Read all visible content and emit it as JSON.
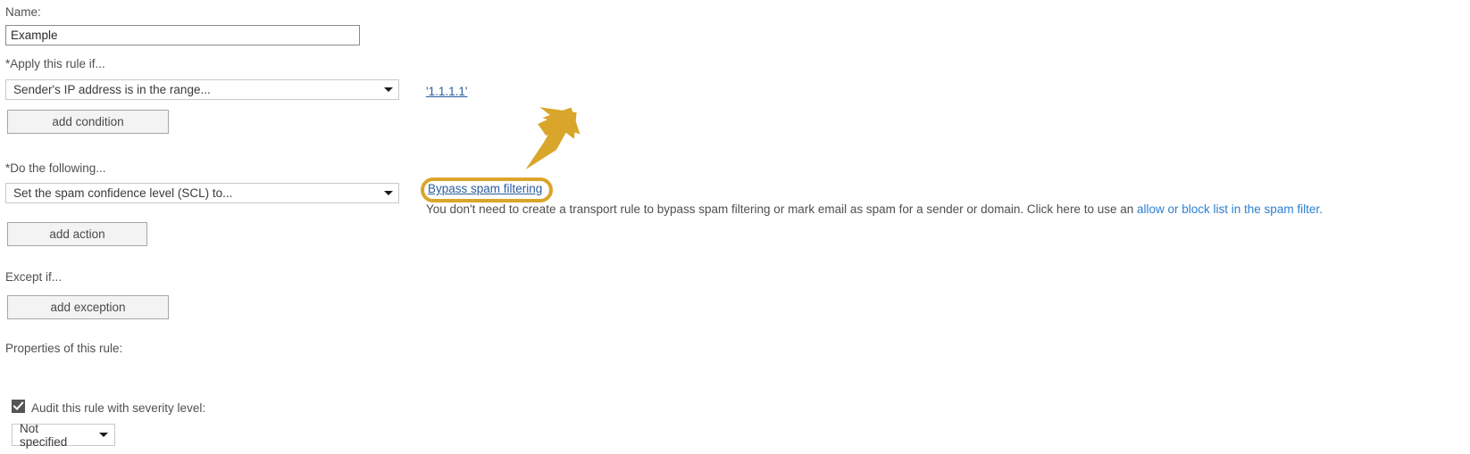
{
  "form": {
    "name_label": "Name:",
    "name_value": "Example",
    "name_placeholder": "",
    "condition_label": "*Apply this rule if...",
    "condition_selected": "Sender's IP address is in the range...",
    "condition_value_link": "'1.1.1.1'",
    "add_condition_label": "add condition",
    "action_label": "*Do the following...",
    "action_selected": "Set the spam confidence level (SCL) to...",
    "action_value_link": "Bypass spam filtering",
    "add_action_label": "add action",
    "helper_text_before": "You don't need to create a transport rule to bypass spam filtering or mark email as spam for a sender or domain. Click here to use an ",
    "helper_link": "allow or block list in the spam filter.",
    "exception_label": "Except if...",
    "add_exception_label": "add exception",
    "properties_label": "Properties of this rule:",
    "audit_checkbox_label": "Audit this rule with severity level:",
    "audit_checked": true,
    "severity_selected": "Not specified"
  },
  "annotations": {
    "highlight_color": "#d9a52a",
    "arrow_color": "#d9a52a",
    "arrow_name": "pointer-arrow"
  },
  "icons": {
    "caret": "chevron-down-icon",
    "check": "check-mark-icon"
  }
}
